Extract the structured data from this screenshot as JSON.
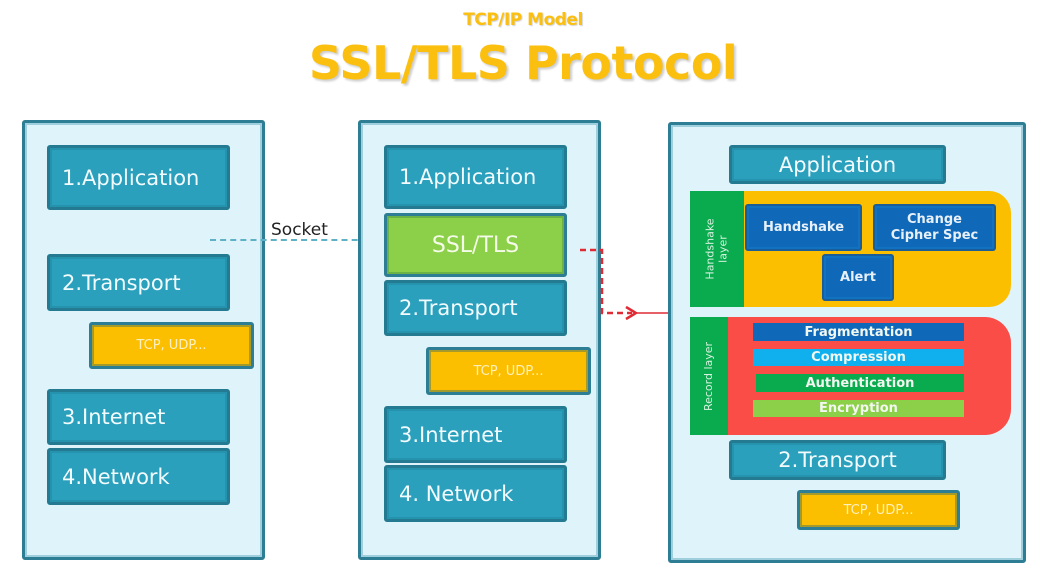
{
  "header": {
    "subtitle": "TCP/IP Model",
    "title": "SSL/TLS Protocol"
  },
  "connector": {
    "socket_label": "Socket"
  },
  "left_stack": {
    "application": "1.Application",
    "transport": "2.Transport",
    "transport_protocols": "TCP, UDP...",
    "internet": "3.Internet",
    "network": "4.Network"
  },
  "middle_stack": {
    "application": "1.Application",
    "security": "SSL/TLS",
    "transport": "2.Transport",
    "transport_protocols": "TCP, UDP...",
    "internet": "3.Internet",
    "network": "4. Network"
  },
  "right_stack": {
    "application": "Application",
    "handshake_layer": {
      "label": "Handshake layer",
      "protocols": [
        "Handshake",
        "Change Cipher Spec",
        "Alert"
      ]
    },
    "record_layer": {
      "label": "Record layer",
      "steps": [
        "Fragmentation",
        "Compression",
        "Authentication",
        "Encryption"
      ]
    },
    "transport": "2.Transport",
    "transport_protocols": "TCP, UDP..."
  },
  "colors": {
    "title": "#fbbf10",
    "layer_blue": "#2aa0bd",
    "ssl_green": "#8ccf48",
    "tcp_yellow": "#fbbf00",
    "handshake_bg": "#fbbf00",
    "record_bg": "#fb4d48",
    "side_label_green": "#0aaa4e",
    "fragmentation": "#0f68b8",
    "compression": "#10b0ee",
    "authentication": "#0aaa4e",
    "encryption": "#8ccf48",
    "arrow_red": "#e02b35"
  }
}
